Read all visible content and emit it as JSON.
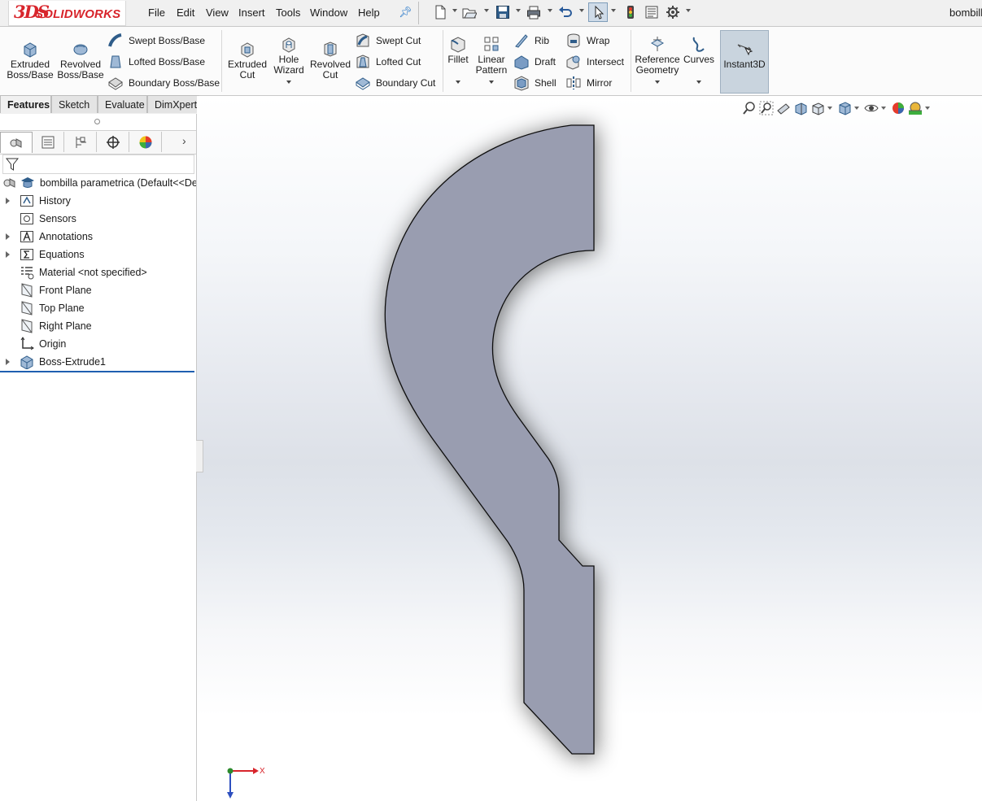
{
  "app": {
    "logo_prefix": "3DS",
    "logo_text": "SOLIDWORKS",
    "document_title": "bombill"
  },
  "menu": [
    "File",
    "Edit",
    "View",
    "Insert",
    "Tools",
    "Window",
    "Help"
  ],
  "toolbar_icons": [
    "new-document-icon",
    "open-icon",
    "save-icon",
    "print-icon",
    "undo-icon",
    "select-icon",
    "rebuild-icon",
    "file-properties-icon",
    "options-icon"
  ],
  "features": {
    "extruded_boss": "Extruded\nBoss/Base",
    "revolved_boss": "Revolved\nBoss/Base",
    "swept_boss": "Swept Boss/Base",
    "lofted_boss": "Lofted Boss/Base",
    "boundary_boss": "Boundary Boss/Base",
    "extruded_cut": "Extruded\nCut",
    "hole_wizard": "Hole\nWizard",
    "revolved_cut": "Revolved\nCut",
    "swept_cut": "Swept Cut",
    "lofted_cut": "Lofted Cut",
    "boundary_cut": "Boundary Cut",
    "fillet": "Fillet",
    "linear_pattern": "Linear\nPattern",
    "rib": "Rib",
    "draft": "Draft",
    "shell": "Shell",
    "wrap": "Wrap",
    "intersect": "Intersect",
    "mirror": "Mirror",
    "reference_geometry": "Reference\nGeometry",
    "curves": "Curves",
    "instant3d": "Instant3D"
  },
  "tabs": [
    "Features",
    "Sketch",
    "Evaluate",
    "DimXpert"
  ],
  "tree": {
    "root": "bombilla parametrica  (Default<<De",
    "items": [
      {
        "label": "History",
        "expandable": true,
        "icon": "history-folder-icon"
      },
      {
        "label": "Sensors",
        "expandable": false,
        "icon": "sensors-folder-icon"
      },
      {
        "label": "Annotations",
        "expandable": true,
        "icon": "annotations-folder-icon"
      },
      {
        "label": "Equations",
        "expandable": true,
        "icon": "equations-folder-icon"
      },
      {
        "label": "Material <not specified>",
        "expandable": false,
        "icon": "material-icon"
      },
      {
        "label": "Front Plane",
        "expandable": false,
        "icon": "plane-icon"
      },
      {
        "label": "Top Plane",
        "expandable": false,
        "icon": "plane-icon"
      },
      {
        "label": "Right Plane",
        "expandable": false,
        "icon": "plane-icon"
      },
      {
        "label": "Origin",
        "expandable": false,
        "icon": "origin-icon"
      },
      {
        "label": "Boss-Extrude1",
        "expandable": true,
        "icon": "boss-extrude-icon"
      }
    ]
  },
  "triad": {
    "x_label": "X",
    "y_label": "Y"
  },
  "colors": {
    "part_face": "#999db0",
    "accent_red": "#d8252c",
    "selection_blue": "#1f5fb0"
  }
}
